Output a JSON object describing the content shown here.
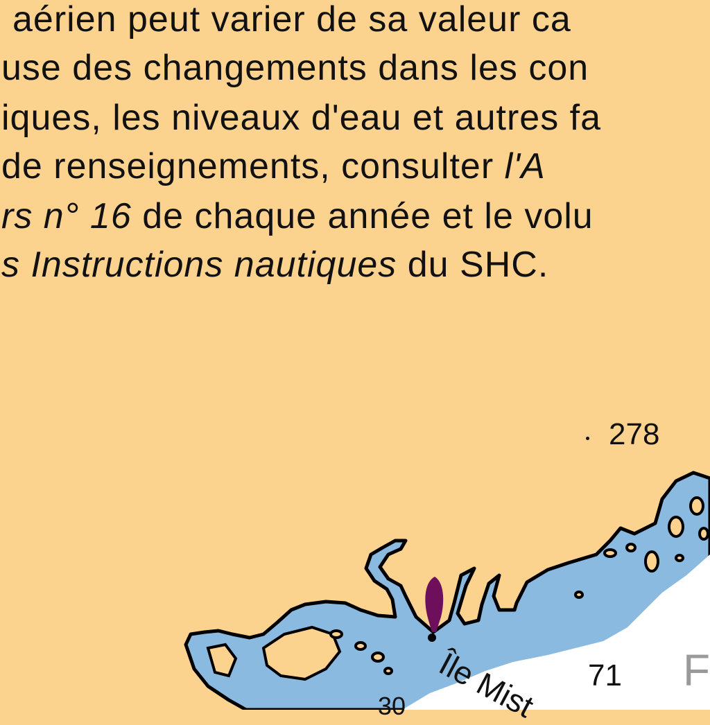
{
  "note": {
    "line1": "aérien peut varier de sa valeur ca",
    "line2": "use des changements dans les con",
    "line3": "iques, les niveaux d'eau et autres fa",
    "line4_a": "de renseignements, consulter ",
    "line4_b": "l'A",
    "line5_a": "rs n° 16",
    "line5_b": " de chaque année et le volu",
    "line6_a": "s Instructions nautiques",
    "line6_b": " du SHC."
  },
  "soundings": {
    "spot_height": "278",
    "depth_71": "71",
    "depth_30": "30"
  },
  "places": {
    "island": "Île Mist",
    "edge_letter": "F"
  },
  "colors": {
    "land": "#FCD28F",
    "shallow_water": "#8BBAE0",
    "deep_water": "#FFFFFF",
    "shoreline": "#000000",
    "beacon": "#6E0F5C",
    "edge_text": "#9A9A9A"
  },
  "icons": {
    "beacon": "buoy-marker-icon",
    "spot": "spot-height-dot"
  }
}
